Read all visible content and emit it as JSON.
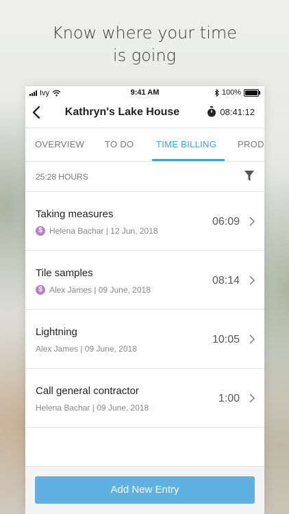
{
  "headline": {
    "line1": "Know where your time",
    "line2": "is going"
  },
  "status_bar": {
    "carrier": "Ivy",
    "time": "9:41 AM",
    "battery": "100%"
  },
  "nav": {
    "title": "Kathryn's Lake House",
    "timer": "08:41:12"
  },
  "tabs": [
    "OVERVIEW",
    "TO DO",
    "TIME BILLING",
    "PRODU"
  ],
  "active_tab": "TIME BILLING",
  "summary": {
    "hours": "25:28 HOURS"
  },
  "entries": [
    {
      "title": "Taking measures",
      "billable": true,
      "billable_icon_text": "$",
      "meta": "Helena Bachar | 12 Jun, 2018",
      "duration": "06:09"
    },
    {
      "title": "Tile samples",
      "billable": true,
      "billable_icon_text": "$",
      "meta": "Alex James | 09 June, 2018",
      "duration": "08:14"
    },
    {
      "title": "Lightning",
      "billable": false,
      "meta": "Alex James | 09 June, 2018",
      "duration": "10:05"
    },
    {
      "title": "Call general contractor",
      "billable": false,
      "meta": "Helena Bachar | 09 June, 2018",
      "duration": "1:00"
    }
  ],
  "footer": {
    "add_button": "Add New Entry"
  },
  "colors": {
    "accent": "#3fa3d6",
    "button": "#5eb1e0",
    "billable_badge": "#b97fc9"
  },
  "icons": [
    "signal-icon",
    "wifi-icon",
    "bluetooth-icon",
    "battery-icon",
    "back-chevron-icon",
    "stopwatch-icon",
    "filter-icon",
    "billable-dollar-icon",
    "chevron-right-icon"
  ]
}
